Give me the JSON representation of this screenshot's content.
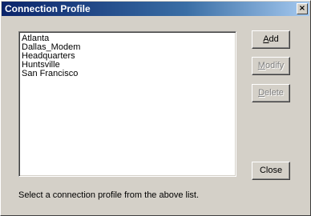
{
  "window": {
    "title": "Connection Profile",
    "close_glyph": "×"
  },
  "profiles": {
    "items": [
      "Atlanta",
      "Dallas_Modem",
      "Headquarters",
      "Huntsville",
      "San Francisco"
    ]
  },
  "buttons": {
    "add": {
      "mnemonic": "A",
      "rest": "dd",
      "enabled": true
    },
    "modify": {
      "mnemonic": "M",
      "rest": "odify",
      "enabled": false
    },
    "delete": {
      "mnemonic": "D",
      "rest": "elete",
      "enabled": false
    },
    "close": {
      "label": "Close",
      "enabled": true
    }
  },
  "status_text": "Select a connection profile from the above list.",
  "colors": {
    "title_bar_start": "#0a246a",
    "title_bar_end": "#a6caf0",
    "face": "#d4d0c8",
    "disabled_text": "#808080"
  }
}
